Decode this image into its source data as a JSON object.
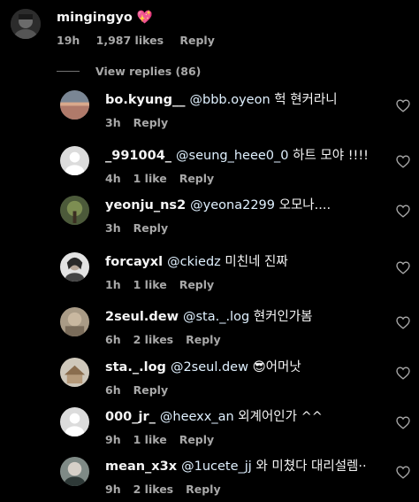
{
  "top_comment": {
    "username": "mingingyo",
    "emoji": "💖",
    "time": "19h",
    "likes": "1,987 likes",
    "reply": "Reply"
  },
  "view_replies": "View replies (86)",
  "replies": [
    {
      "username": "bo.kyung__",
      "mention": "@bbb.oyeon",
      "text": "헉 현커라니",
      "time": "3h",
      "likes": "",
      "reply": "Reply"
    },
    {
      "username": "_991004_",
      "mention": "@seung_heee0_0",
      "text": "하트 모야 !!!!",
      "time": "4h",
      "likes": "1 like",
      "reply": "Reply"
    },
    {
      "username": "yeonju_ns2",
      "mention": "@yeona2299",
      "text": "오모나....",
      "time": "3h",
      "likes": "",
      "reply": "Reply"
    },
    {
      "username": "forcayxl",
      "mention": "@ckiedz",
      "text": "미친네 진짜",
      "time": "1h",
      "likes": "1 like",
      "reply": "Reply"
    },
    {
      "username": "2seul.dew",
      "mention": "@sta._.log",
      "text": "현커인가봄",
      "time": "6h",
      "likes": "2 likes",
      "reply": "Reply"
    },
    {
      "username": "sta._.log",
      "mention": "@2seul.dew",
      "text": "😎어머낫",
      "time": "6h",
      "likes": "",
      "reply": "Reply"
    },
    {
      "username": "000_jr_",
      "mention": "@heexx_an",
      "text": "외계어인가 ^^",
      "time": "9h",
      "likes": "1 like",
      "reply": "Reply"
    },
    {
      "username": "mean_x3x",
      "mention": "@1ucete_jj",
      "text": "와 미쳤다 대리설렘··",
      "time": "9h",
      "likes": "2 likes",
      "reply": "Reply"
    }
  ],
  "colors": {
    "background": "#000000",
    "primary_text": "#f5f5f5",
    "secondary_text": "#a8a8a8",
    "mention": "#e0f1ff"
  },
  "icons": {
    "like": "heart-outline-icon"
  }
}
